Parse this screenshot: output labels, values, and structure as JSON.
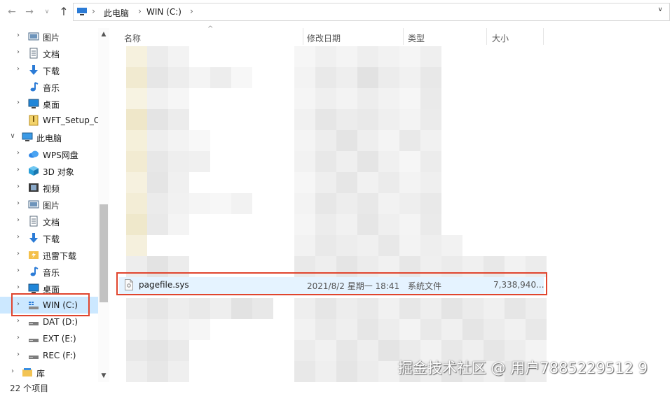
{
  "address": {
    "crumbs": [
      "此电脑",
      "WIN (C:)"
    ],
    "separator": "›",
    "root_icon": "pc-icon"
  },
  "nav": {
    "back_icon": "arrow-left-icon",
    "forward_icon": "arrow-right-icon",
    "recent_icon": "chevron-down-icon",
    "up_icon": "arrow-up-icon"
  },
  "sidebar": {
    "items": [
      {
        "label": "图片",
        "icon": "pictures-icon"
      },
      {
        "label": "文档",
        "icon": "documents-icon"
      },
      {
        "label": "下载",
        "icon": "downloads-icon"
      },
      {
        "label": "音乐",
        "icon": "music-icon"
      },
      {
        "label": "桌面",
        "icon": "desktop-icon"
      },
      {
        "label": "WFT_Setup_Cl",
        "icon": "zip-folder-icon"
      },
      {
        "label": "此电脑",
        "icon": "pc-icon"
      },
      {
        "label": "WPS网盘",
        "icon": "cloud-icon"
      },
      {
        "label": "3D 对象",
        "icon": "cube-icon"
      },
      {
        "label": "视频",
        "icon": "video-icon"
      },
      {
        "label": "图片",
        "icon": "pictures-icon"
      },
      {
        "label": "文档",
        "icon": "documents-icon"
      },
      {
        "label": "下载",
        "icon": "downloads-icon"
      },
      {
        "label": "迅雷下载",
        "icon": "thunder-folder-icon"
      },
      {
        "label": "音乐",
        "icon": "music-icon"
      },
      {
        "label": "桌面",
        "icon": "desktop-icon"
      },
      {
        "label": "WIN (C:)",
        "icon": "system-drive-icon"
      },
      {
        "label": "DAT (D:)",
        "icon": "drive-icon"
      },
      {
        "label": "EXT (E:)",
        "icon": "drive-icon"
      },
      {
        "label": "REC (F:)",
        "icon": "drive-icon"
      },
      {
        "label": "库",
        "icon": "library-icon"
      }
    ],
    "status": "22 个项目"
  },
  "columns": {
    "name": "名称",
    "modified": "修改日期",
    "type": "类型",
    "size": "大小"
  },
  "file": {
    "name": "pagefile.sys",
    "modified": "2021/8/2 星期一 18:41",
    "type": "系统文件",
    "size": "7,338,940...",
    "icon": "system-file-icon"
  },
  "watermark": "掘金技术社区 @ 用户7885229512 9",
  "colors": {
    "selection": "#cce8ff",
    "row_highlight": "#e5f3ff",
    "annotation": "#e0452e"
  }
}
